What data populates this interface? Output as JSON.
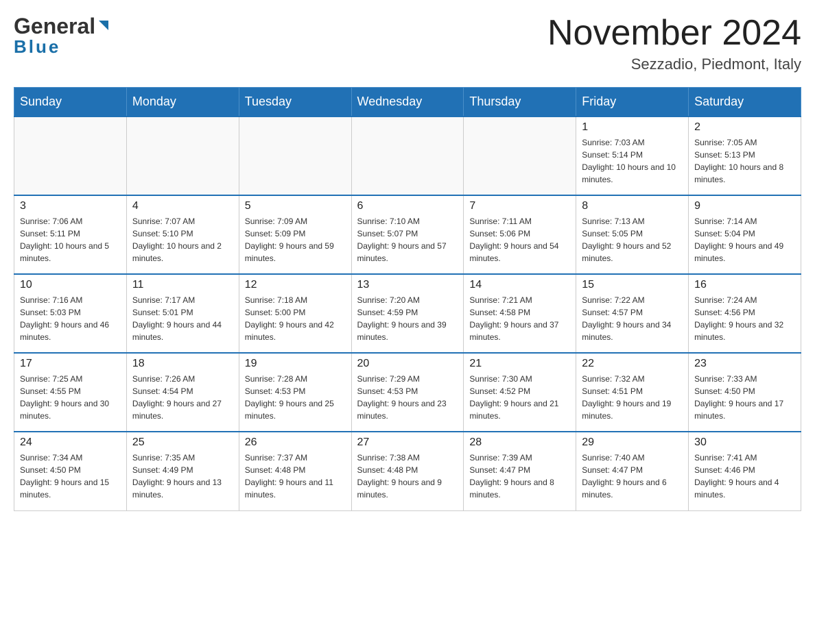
{
  "header": {
    "logo_general": "General",
    "logo_blue": "Blue",
    "month_year": "November 2024",
    "location": "Sezzadio, Piedmont, Italy"
  },
  "weekdays": [
    "Sunday",
    "Monday",
    "Tuesday",
    "Wednesday",
    "Thursday",
    "Friday",
    "Saturday"
  ],
  "weeks": [
    [
      {
        "day": "",
        "sunrise": "",
        "sunset": "",
        "daylight": ""
      },
      {
        "day": "",
        "sunrise": "",
        "sunset": "",
        "daylight": ""
      },
      {
        "day": "",
        "sunrise": "",
        "sunset": "",
        "daylight": ""
      },
      {
        "day": "",
        "sunrise": "",
        "sunset": "",
        "daylight": ""
      },
      {
        "day": "",
        "sunrise": "",
        "sunset": "",
        "daylight": ""
      },
      {
        "day": "1",
        "sunrise": "Sunrise: 7:03 AM",
        "sunset": "Sunset: 5:14 PM",
        "daylight": "Daylight: 10 hours and 10 minutes."
      },
      {
        "day": "2",
        "sunrise": "Sunrise: 7:05 AM",
        "sunset": "Sunset: 5:13 PM",
        "daylight": "Daylight: 10 hours and 8 minutes."
      }
    ],
    [
      {
        "day": "3",
        "sunrise": "Sunrise: 7:06 AM",
        "sunset": "Sunset: 5:11 PM",
        "daylight": "Daylight: 10 hours and 5 minutes."
      },
      {
        "day": "4",
        "sunrise": "Sunrise: 7:07 AM",
        "sunset": "Sunset: 5:10 PM",
        "daylight": "Daylight: 10 hours and 2 minutes."
      },
      {
        "day": "5",
        "sunrise": "Sunrise: 7:09 AM",
        "sunset": "Sunset: 5:09 PM",
        "daylight": "Daylight: 9 hours and 59 minutes."
      },
      {
        "day": "6",
        "sunrise": "Sunrise: 7:10 AM",
        "sunset": "Sunset: 5:07 PM",
        "daylight": "Daylight: 9 hours and 57 minutes."
      },
      {
        "day": "7",
        "sunrise": "Sunrise: 7:11 AM",
        "sunset": "Sunset: 5:06 PM",
        "daylight": "Daylight: 9 hours and 54 minutes."
      },
      {
        "day": "8",
        "sunrise": "Sunrise: 7:13 AM",
        "sunset": "Sunset: 5:05 PM",
        "daylight": "Daylight: 9 hours and 52 minutes."
      },
      {
        "day": "9",
        "sunrise": "Sunrise: 7:14 AM",
        "sunset": "Sunset: 5:04 PM",
        "daylight": "Daylight: 9 hours and 49 minutes."
      }
    ],
    [
      {
        "day": "10",
        "sunrise": "Sunrise: 7:16 AM",
        "sunset": "Sunset: 5:03 PM",
        "daylight": "Daylight: 9 hours and 46 minutes."
      },
      {
        "day": "11",
        "sunrise": "Sunrise: 7:17 AM",
        "sunset": "Sunset: 5:01 PM",
        "daylight": "Daylight: 9 hours and 44 minutes."
      },
      {
        "day": "12",
        "sunrise": "Sunrise: 7:18 AM",
        "sunset": "Sunset: 5:00 PM",
        "daylight": "Daylight: 9 hours and 42 minutes."
      },
      {
        "day": "13",
        "sunrise": "Sunrise: 7:20 AM",
        "sunset": "Sunset: 4:59 PM",
        "daylight": "Daylight: 9 hours and 39 minutes."
      },
      {
        "day": "14",
        "sunrise": "Sunrise: 7:21 AM",
        "sunset": "Sunset: 4:58 PM",
        "daylight": "Daylight: 9 hours and 37 minutes."
      },
      {
        "day": "15",
        "sunrise": "Sunrise: 7:22 AM",
        "sunset": "Sunset: 4:57 PM",
        "daylight": "Daylight: 9 hours and 34 minutes."
      },
      {
        "day": "16",
        "sunrise": "Sunrise: 7:24 AM",
        "sunset": "Sunset: 4:56 PM",
        "daylight": "Daylight: 9 hours and 32 minutes."
      }
    ],
    [
      {
        "day": "17",
        "sunrise": "Sunrise: 7:25 AM",
        "sunset": "Sunset: 4:55 PM",
        "daylight": "Daylight: 9 hours and 30 minutes."
      },
      {
        "day": "18",
        "sunrise": "Sunrise: 7:26 AM",
        "sunset": "Sunset: 4:54 PM",
        "daylight": "Daylight: 9 hours and 27 minutes."
      },
      {
        "day": "19",
        "sunrise": "Sunrise: 7:28 AM",
        "sunset": "Sunset: 4:53 PM",
        "daylight": "Daylight: 9 hours and 25 minutes."
      },
      {
        "day": "20",
        "sunrise": "Sunrise: 7:29 AM",
        "sunset": "Sunset: 4:53 PM",
        "daylight": "Daylight: 9 hours and 23 minutes."
      },
      {
        "day": "21",
        "sunrise": "Sunrise: 7:30 AM",
        "sunset": "Sunset: 4:52 PM",
        "daylight": "Daylight: 9 hours and 21 minutes."
      },
      {
        "day": "22",
        "sunrise": "Sunrise: 7:32 AM",
        "sunset": "Sunset: 4:51 PM",
        "daylight": "Daylight: 9 hours and 19 minutes."
      },
      {
        "day": "23",
        "sunrise": "Sunrise: 7:33 AM",
        "sunset": "Sunset: 4:50 PM",
        "daylight": "Daylight: 9 hours and 17 minutes."
      }
    ],
    [
      {
        "day": "24",
        "sunrise": "Sunrise: 7:34 AM",
        "sunset": "Sunset: 4:50 PM",
        "daylight": "Daylight: 9 hours and 15 minutes."
      },
      {
        "day": "25",
        "sunrise": "Sunrise: 7:35 AM",
        "sunset": "Sunset: 4:49 PM",
        "daylight": "Daylight: 9 hours and 13 minutes."
      },
      {
        "day": "26",
        "sunrise": "Sunrise: 7:37 AM",
        "sunset": "Sunset: 4:48 PM",
        "daylight": "Daylight: 9 hours and 11 minutes."
      },
      {
        "day": "27",
        "sunrise": "Sunrise: 7:38 AM",
        "sunset": "Sunset: 4:48 PM",
        "daylight": "Daylight: 9 hours and 9 minutes."
      },
      {
        "day": "28",
        "sunrise": "Sunrise: 7:39 AM",
        "sunset": "Sunset: 4:47 PM",
        "daylight": "Daylight: 9 hours and 8 minutes."
      },
      {
        "day": "29",
        "sunrise": "Sunrise: 7:40 AM",
        "sunset": "Sunset: 4:47 PM",
        "daylight": "Daylight: 9 hours and 6 minutes."
      },
      {
        "day": "30",
        "sunrise": "Sunrise: 7:41 AM",
        "sunset": "Sunset: 4:46 PM",
        "daylight": "Daylight: 9 hours and 4 minutes."
      }
    ]
  ]
}
